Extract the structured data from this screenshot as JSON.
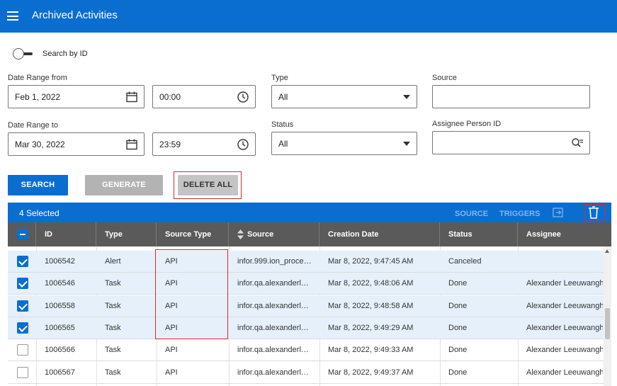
{
  "header": {
    "title": "Archived Activities",
    "menu_icon": "hamburger-menu-icon"
  },
  "search_by_id": {
    "label": "Search by ID",
    "enabled": false
  },
  "filters": {
    "date_from": {
      "label": "Date Range from",
      "date": "Feb 1, 2022",
      "time": "00:00"
    },
    "date_to": {
      "label": "Date Range to",
      "date": "Mar 30, 2022",
      "time": "23:59"
    },
    "type": {
      "label": "Type",
      "value": "All"
    },
    "status": {
      "label": "Status",
      "value": "All"
    },
    "source": {
      "label": "Source",
      "value": ""
    },
    "assignee": {
      "label": "Assignee Person ID",
      "value": ""
    }
  },
  "buttons": {
    "search": "SEARCH",
    "generate_report": "GENERATE REPORT",
    "delete_all": "DELETE ALL"
  },
  "grid": {
    "selected_text": "4 Selected",
    "toolbar": {
      "source": "SOURCE",
      "triggers": "TRIGGERS"
    },
    "columns": [
      "ID",
      "Type",
      "Source Type",
      "Source",
      "Creation Date",
      "Status",
      "Assignee"
    ],
    "rows": [
      {
        "checked": true,
        "id": "1006542",
        "type": "Alert",
        "source_type": "API",
        "source": "infor.999.ion_proce…",
        "creation_date": "Mar 8, 2022, 9:47:45 AM",
        "status": "Canceled",
        "assignee": ""
      },
      {
        "checked": true,
        "id": "1006546",
        "type": "Task",
        "source_type": "API",
        "source": "infor.qa.alexanderl…",
        "creation_date": "Mar 8, 2022, 9:48:06 AM",
        "status": "Done",
        "assignee": "Alexander Leeuwangh"
      },
      {
        "checked": true,
        "id": "1006558",
        "type": "Task",
        "source_type": "API",
        "source": "infor.qa.alexanderl…",
        "creation_date": "Mar 8, 2022, 9:48:58 AM",
        "status": "Done",
        "assignee": "Alexander Leeuwangh"
      },
      {
        "checked": true,
        "id": "1006565",
        "type": "Task",
        "source_type": "API",
        "source": "infor.qa.alexanderl…",
        "creation_date": "Mar 8, 2022, 9:49:29 AM",
        "status": "Done",
        "assignee": "Alexander Leeuwangh"
      },
      {
        "checked": false,
        "id": "1006566",
        "type": "Task",
        "source_type": "API",
        "source": "infor.qa.alexanderl…",
        "creation_date": "Mar 8, 2022, 9:49:33 AM",
        "status": "Done",
        "assignee": "Alexander Leeuwangh"
      },
      {
        "checked": false,
        "id": "1006567",
        "type": "Task",
        "source_type": "API",
        "source": "infor.qa.alexanderl…",
        "creation_date": "Mar 8, 2022, 9:49:37 AM",
        "status": "Done",
        "assignee": "Alexander Leeuwangh"
      }
    ]
  },
  "colors": {
    "brand_blue": "#0a6ed1",
    "header_gray": "#5a5a5a",
    "highlight_red": "#d42b2b",
    "selected_row": "#e6f0fa"
  }
}
